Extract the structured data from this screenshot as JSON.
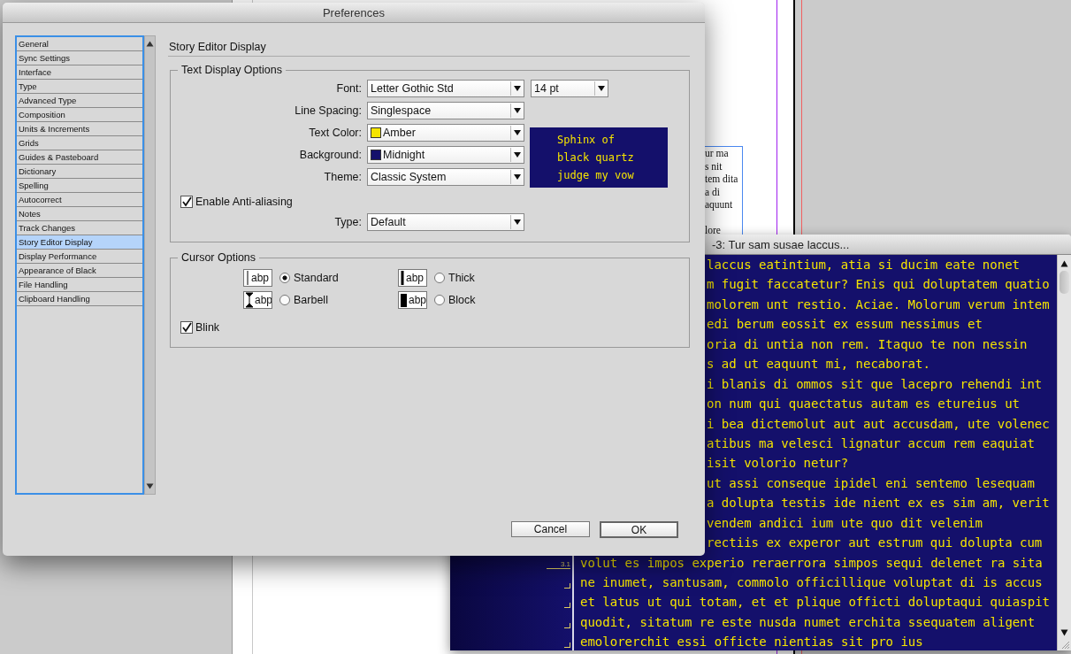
{
  "document": {
    "text_blocks": [
      [
        "ur ma",
        "s nit",
        "tem dita",
        "a di",
        "aquunt"
      ],
      [
        "lore"
      ]
    ]
  },
  "story_editor": {
    "title": "-3: Tur sam susae laccus...",
    "covered_lines": [
      "laccus eatintium, atia si ducim eate nonet",
      "m fugit faccatetur? Enis qui doluptatem quatio",
      "molorem unt restio. Aciae. Molorum verum intem",
      "edi berum eossit ex essum nessimus et",
      "oria di untia non rem. Itaquo te non nessin",
      "s ad ut eaquunt mi, necaborat.",
      "i blanis di ommos sit que lacepro rehendi int",
      "on num qui quaectatus autam es etureius ut",
      "i bea dictemolut aut aut accusdam, ute volenec",
      "atibus ma velesci lignatur accum rem eaquiat",
      "isit volorio netur?",
      "ut assi conseque ipidel eni sentemo lesequam",
      "a dolupta testis ide nient ex es sim am, verit",
      "vendem andici ium ute quo dit velenim",
      "rectiis ex experor aut estrum qui dolupta cum"
    ],
    "lines": [
      {
        "number": "3.1",
        "text": "volut es impos experio reraerrora simpos sequi delenet ra sita"
      },
      {
        "text": "ne inumet, santusam, commolo officillique voluptat di is accus"
      },
      {
        "text": "et latus ut qui totam, et et plique officti doluptaqui quiaspit"
      },
      {
        "text": "quodit, sitatum re este nusda numet erchita ssequatem aligent"
      },
      {
        "text": "emolorerchit essi officte nientias sit pro ius"
      }
    ]
  },
  "dialog": {
    "title": "Preferences",
    "sidebar": [
      {
        "label": "General",
        "selected": false
      },
      {
        "label": "Sync Settings",
        "selected": false
      },
      {
        "label": "Interface",
        "selected": false
      },
      {
        "label": "Type",
        "selected": false
      },
      {
        "label": "Advanced Type",
        "selected": false
      },
      {
        "label": "Composition",
        "selected": false
      },
      {
        "label": "Units & Increments",
        "selected": false
      },
      {
        "label": "Grids",
        "selected": false
      },
      {
        "label": "Guides & Pasteboard",
        "selected": false
      },
      {
        "label": "Dictionary",
        "selected": false
      },
      {
        "label": "Spelling",
        "selected": false
      },
      {
        "label": "Autocorrect",
        "selected": false
      },
      {
        "label": "Notes",
        "selected": false
      },
      {
        "label": "Track Changes",
        "selected": false
      },
      {
        "label": "Story Editor Display",
        "selected": true
      },
      {
        "label": "Display Performance",
        "selected": false
      },
      {
        "label": "Appearance of Black",
        "selected": false
      },
      {
        "label": "File Handling",
        "selected": false
      },
      {
        "label": "Clipboard Handling",
        "selected": false
      }
    ],
    "heading": "Story Editor Display",
    "text_display": {
      "legend": "Text Display Options",
      "font": {
        "label": "Font:",
        "value": "Letter Gothic Std",
        "size": "14 pt"
      },
      "line_spacing": {
        "label": "Line Spacing:",
        "value": "Singlespace"
      },
      "text_color": {
        "label": "Text Color:",
        "value": "Amber",
        "color": "#f5e400"
      },
      "background": {
        "label": "Background:",
        "value": "Midnight",
        "color": "#14106b"
      },
      "theme": {
        "label": "Theme:",
        "value": "Classic System"
      },
      "preview": [
        "Sphinx of",
        "black quartz",
        "judge my vow"
      ],
      "anti_aliasing": {
        "label": "Enable Anti-aliasing",
        "checked": true
      },
      "type": {
        "label": "Type:",
        "value": "Default"
      }
    },
    "cursor": {
      "legend": "Cursor Options",
      "options": [
        {
          "kind": "standard",
          "sample": "abp",
          "label": "Standard",
          "selected": true
        },
        {
          "kind": "thick",
          "sample": "abp",
          "label": "Thick",
          "selected": false
        },
        {
          "kind": "barbell",
          "sample": "abp",
          "label": "Barbell",
          "selected": false
        },
        {
          "kind": "block",
          "sample": "abp",
          "label": "Block",
          "selected": false
        }
      ],
      "blink": {
        "label": "Blink",
        "checked": true
      }
    },
    "buttons": [
      {
        "label": "Cancel",
        "default": false
      },
      {
        "label": "OK",
        "default": true
      }
    ]
  }
}
